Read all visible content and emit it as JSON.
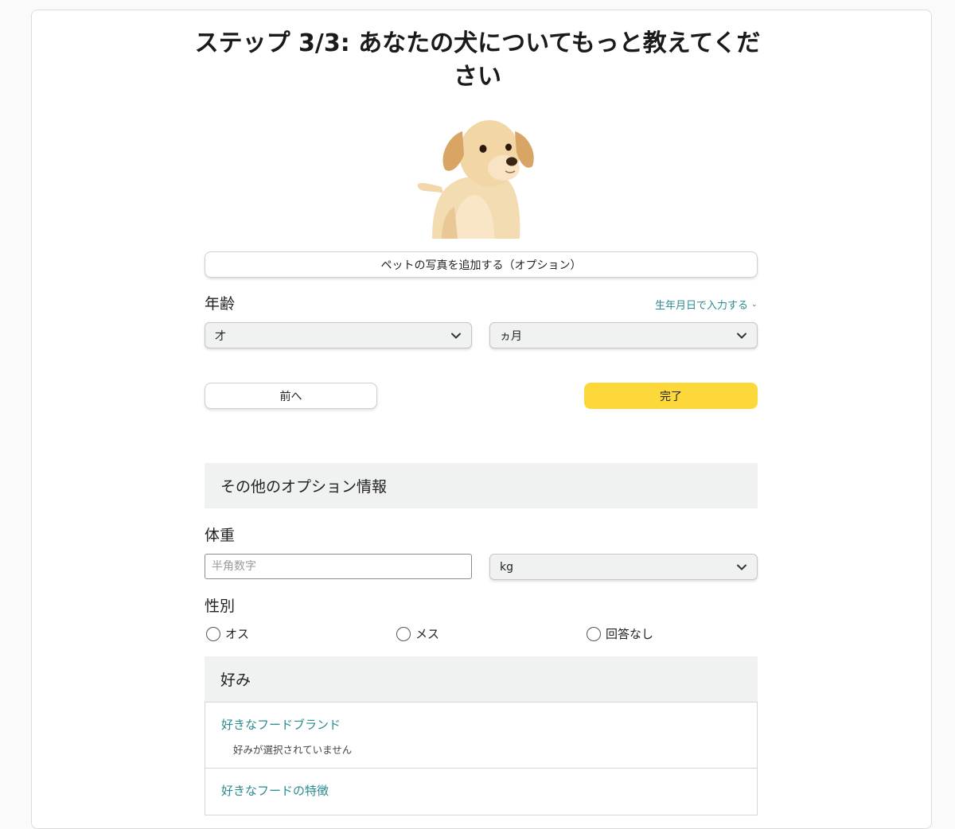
{
  "page": {
    "title": "ステップ 3/3: あなたの犬についてもっと教えてください"
  },
  "photo_button": {
    "label": "ペットの写真を追加する（オプション）"
  },
  "age": {
    "label": "年齢",
    "dob_link": "生年月日で入力する",
    "years_select": "才",
    "months_select": "ヵ月"
  },
  "nav": {
    "prev_label": "前へ",
    "done_label": "完了"
  },
  "other_section": {
    "title": "その他のオプション情報"
  },
  "weight": {
    "label": "体重",
    "placeholder": "半角数字",
    "unit_select": "kg"
  },
  "gender": {
    "label": "性別",
    "options": [
      "オス",
      "メス",
      "回答なし"
    ]
  },
  "preferences": {
    "title": "好み",
    "items": [
      {
        "label": "好きなフードブランド",
        "empty_text": "好みが選択されていません"
      },
      {
        "label": "好きなフードの特徴"
      }
    ]
  },
  "colors": {
    "accent_teal": "#2a8a8e",
    "done_yellow": "#fdd83b",
    "section_gray": "#f0f1f1"
  }
}
